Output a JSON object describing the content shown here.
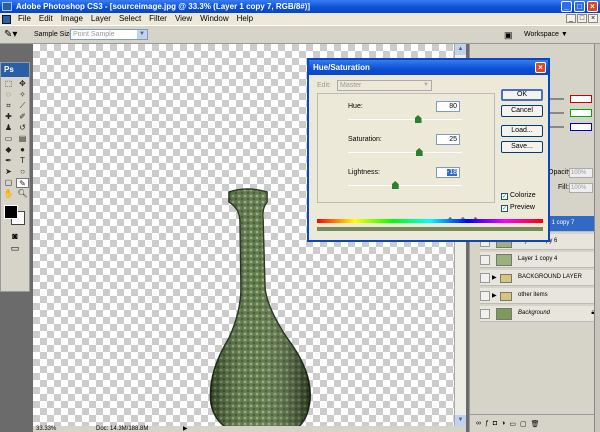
{
  "window": {
    "title": "Adobe Photoshop CS3 - [sourceimage.jpg @ 33.3% (Layer 1 copy 7, RGB/8#)]",
    "btn_min": "_",
    "btn_max": "□",
    "btn_close": "×"
  },
  "menu": {
    "items": [
      "File",
      "Edit",
      "Image",
      "Layer",
      "Select",
      "Filter",
      "View",
      "Window",
      "Help"
    ],
    "doc_controls": [
      "_",
      "□",
      "×"
    ]
  },
  "options_bar": {
    "sample_size_label": "Sample Size:",
    "sample_size_value": "Point Sample",
    "workspace_label": "Workspace ▼"
  },
  "toolbox": {
    "header": "Ps"
  },
  "status_bar": {
    "zoom": "33.33%",
    "doc": "Doc: 14.3M/188.8M"
  },
  "dialog": {
    "title": "Hue/Saturation",
    "edit_label": "Edit:",
    "edit_value": "Master",
    "hue": {
      "label": "Hue:",
      "value": "80",
      "fraction": 0.61
    },
    "saturation": {
      "label": "Saturation:",
      "value": "25",
      "fraction": 0.62
    },
    "lightness": {
      "label": "Lightness:",
      "value": "-18",
      "fraction": 0.41
    },
    "buttons": {
      "ok": "OK",
      "cancel": "Cancel",
      "load": "Load...",
      "save": "Save..."
    },
    "colorize": {
      "label": "Colorize",
      "checked": true
    },
    "preview": {
      "label": "Preview",
      "checked": true
    },
    "colorized_bar_color": "#7a8a56"
  },
  "palette": {
    "opacity_label": "Opacity:",
    "opacity_value": "100%",
    "fill_label": "Fill:",
    "fill_value": "100%",
    "layers": [
      {
        "name": "Layer 1 copy 7",
        "selected": true,
        "kind": "layer",
        "visible_text": "r 1 copy 7"
      },
      {
        "name": "Layer 1 copy 6",
        "selected": false,
        "kind": "layer"
      },
      {
        "name": "Layer 1 copy 4",
        "selected": false,
        "kind": "layer"
      },
      {
        "name": "BACKGROUND LAYER",
        "selected": false,
        "kind": "group"
      },
      {
        "name": "other items",
        "selected": false,
        "kind": "group"
      },
      {
        "name": "Background",
        "selected": false,
        "kind": "background",
        "locked": true
      }
    ]
  },
  "colors": {
    "xp_blue": "#0a4fd6",
    "selection": "#316ac5",
    "vase_green": "#4f6b3a"
  }
}
